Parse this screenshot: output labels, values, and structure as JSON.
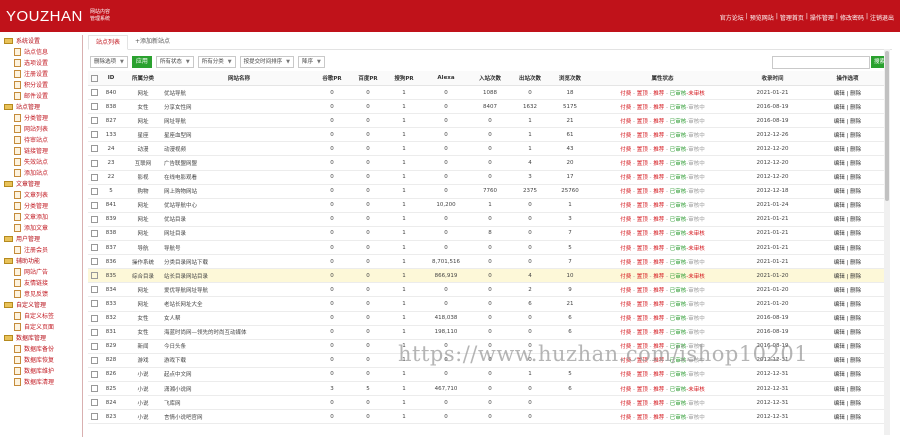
{
  "header": {
    "logo": "YOUZHAN",
    "logo_sub1": "网站内容",
    "logo_sub2": "管理系统",
    "links": [
      "官方论坛",
      "|",
      "预览网站",
      "|",
      "管理首页",
      "|",
      "操作管理",
      "|",
      "修改密码",
      "|",
      "注销退出"
    ]
  },
  "sidebar": {
    "groups": [
      {
        "title": "系统设置",
        "items": [
          "站点信息",
          "选项设置",
          "注册设置",
          "积分设置",
          "邮件设置"
        ]
      },
      {
        "title": "站点管理",
        "items": [
          "分类管理",
          "网站列表",
          "待审站点",
          "链接管理",
          "失效站点",
          "添加站点"
        ]
      },
      {
        "title": "文章管理",
        "items": [
          "文章列表",
          "分类管理",
          "文章添加",
          "添加文章"
        ]
      },
      {
        "title": "用户管理",
        "items": [
          "注册会员"
        ]
      },
      {
        "title": "辅助功能",
        "items": [
          "网站广告",
          "友情链接",
          "意见反馈"
        ]
      },
      {
        "title": "自定义管理",
        "items": [
          "自定义标签",
          "自定义页面"
        ]
      },
      {
        "title": "数据库管理",
        "items": [
          "数据库备份",
          "数据库恢复",
          "数据库维护",
          "数据库清理"
        ]
      }
    ]
  },
  "tabs": [
    "站点列表",
    "+添加新站点"
  ],
  "toolbar": {
    "batch": "删除选项",
    "apply": "应用",
    "status": "所有状态",
    "category": "所有分类",
    "sort_field": "按提交时间排序",
    "order": "降序",
    "search_placeholder": "",
    "search_button": "搜索"
  },
  "table": {
    "headers": [
      "",
      "ID",
      "所属分类",
      "网站名称",
      "谷歌PR",
      "百度PR",
      "搜狗PR",
      "Alexa",
      "入站次数",
      "出站次数",
      "浏览次数",
      "属性状态",
      "收录时间",
      "操作选项"
    ],
    "rows": [
      {
        "id": "840",
        "cat": "网址",
        "name": "优站导航",
        "g": "0",
        "b": "0",
        "s": "1",
        "alexa": "0",
        "in": "1088",
        "out": "0",
        "views": "18",
        "date": "2021-01-21",
        "status": [
          "付费",
          "置顶",
          "推荐",
          "已审核",
          "-未审核"
        ],
        "hl": false
      },
      {
        "id": "838",
        "cat": "女性",
        "name": "分享女性网",
        "g": "0",
        "b": "0",
        "s": "1",
        "alexa": "0",
        "in": "8407",
        "out": "1632",
        "views": "5175",
        "date": "2016-08-19",
        "status": [
          "付费",
          "置顶",
          "推荐",
          "已审核",
          "-审核中"
        ],
        "hl": false
      },
      {
        "id": "827",
        "cat": "网址",
        "name": "网址导航",
        "g": "0",
        "b": "0",
        "s": "1",
        "alexa": "0",
        "in": "0",
        "out": "1",
        "views": "21",
        "date": "2016-08-19",
        "status": [
          "付费",
          "置顶",
          "推荐",
          "已审核",
          "-审核中"
        ],
        "hl": false
      },
      {
        "id": "133",
        "cat": "星座",
        "name": "星座血型网",
        "g": "0",
        "b": "0",
        "s": "1",
        "alexa": "0",
        "in": "0",
        "out": "1",
        "views": "61",
        "date": "2012-12-26",
        "status": [
          "付费",
          "置顶",
          "推荐",
          "已审核",
          "-审核中"
        ],
        "hl": false
      },
      {
        "id": "24",
        "cat": "动漫",
        "name": "动漫视频",
        "g": "0",
        "b": "0",
        "s": "1",
        "alexa": "0",
        "in": "0",
        "out": "1",
        "views": "43",
        "date": "2012-12-20",
        "status": [
          "付费",
          "置顶",
          "推荐",
          "已审核",
          "-审核中"
        ],
        "hl": false
      },
      {
        "id": "23",
        "cat": "互联网",
        "name": "广告联盟网盟",
        "g": "0",
        "b": "0",
        "s": "1",
        "alexa": "0",
        "in": "0",
        "out": "4",
        "views": "20",
        "date": "2012-12-20",
        "status": [
          "付费",
          "置顶",
          "推荐",
          "已审核",
          "-审核中"
        ],
        "hl": false
      },
      {
        "id": "22",
        "cat": "影视",
        "name": "在线电影观看",
        "g": "0",
        "b": "0",
        "s": "1",
        "alexa": "0",
        "in": "0",
        "out": "3",
        "views": "17",
        "date": "2012-12-20",
        "status": [
          "付费",
          "置顶",
          "推荐",
          "已审核",
          "-审核中"
        ],
        "hl": false
      },
      {
        "id": "5",
        "cat": "购物",
        "name": "网上购物网站",
        "g": "0",
        "b": "0",
        "s": "1",
        "alexa": "0",
        "in": "7760",
        "out": "2375",
        "views": "25760",
        "date": "2012-12-18",
        "status": [
          "付费",
          "置顶",
          "推荐",
          "已审核",
          "-审核中"
        ],
        "hl": false
      },
      {
        "id": "841",
        "cat": "网址",
        "name": "优站导航中心",
        "g": "0",
        "b": "0",
        "s": "1",
        "alexa": "10,200",
        "in": "1",
        "out": "0",
        "views": "1",
        "date": "2021-01-24",
        "status": [
          "付费",
          "置顶",
          "推荐",
          "已审核",
          "-审核中"
        ],
        "hl": false
      },
      {
        "id": "839",
        "cat": "网址",
        "name": "优站目录",
        "g": "0",
        "b": "0",
        "s": "1",
        "alexa": "0",
        "in": "0",
        "out": "0",
        "views": "3",
        "date": "2021-01-21",
        "status": [
          "付费",
          "置顶",
          "推荐",
          "已审核",
          "-审核中"
        ],
        "hl": false
      },
      {
        "id": "838",
        "cat": "网址",
        "name": "网址目录",
        "g": "0",
        "b": "0",
        "s": "1",
        "alexa": "0",
        "in": "8",
        "out": "0",
        "views": "7",
        "date": "2021-01-21",
        "status": [
          "付费",
          "置顶",
          "推荐",
          "已审核",
          "-未审核"
        ],
        "hl": false
      },
      {
        "id": "837",
        "cat": "导航",
        "name": "导航号",
        "g": "0",
        "b": "0",
        "s": "1",
        "alexa": "0",
        "in": "0",
        "out": "0",
        "views": "5",
        "date": "2021-01-21",
        "status": [
          "付费",
          "置顶",
          "推荐",
          "已审核",
          "-未审核"
        ],
        "hl": false
      },
      {
        "id": "836",
        "cat": "操作系统",
        "name": "分类目录网站下载",
        "g": "0",
        "b": "0",
        "s": "1",
        "alexa": "8,701,516",
        "in": "0",
        "out": "0",
        "views": "7",
        "date": "2021-01-21",
        "status": [
          "付费",
          "置顶",
          "推荐",
          "已审核",
          "-审核中"
        ],
        "hl": false
      },
      {
        "id": "835",
        "cat": "综合目录",
        "name": "站长目录网站目录",
        "g": "0",
        "b": "0",
        "s": "1",
        "alexa": "866,919",
        "in": "0",
        "out": "4",
        "views": "10",
        "date": "2021-01-20",
        "status": [
          "付费",
          "置顶",
          "推荐",
          "已审核",
          "-未审核"
        ],
        "hl": true
      },
      {
        "id": "834",
        "cat": "网址",
        "name": "爱优导航网址导航",
        "g": "0",
        "b": "0",
        "s": "1",
        "alexa": "0",
        "in": "0",
        "out": "2",
        "views": "9",
        "date": "2021-01-20",
        "status": [
          "付费",
          "置顶",
          "推荐",
          "已审核",
          "-审核中"
        ],
        "hl": false
      },
      {
        "id": "833",
        "cat": "网址",
        "name": "老站长网址大全",
        "g": "0",
        "b": "0",
        "s": "1",
        "alexa": "0",
        "in": "0",
        "out": "6",
        "views": "21",
        "date": "2021-01-20",
        "status": [
          "付费",
          "置顶",
          "推荐",
          "已审核",
          "-审核中"
        ],
        "hl": false
      },
      {
        "id": "832",
        "cat": "女性",
        "name": "女人帮",
        "g": "0",
        "b": "0",
        "s": "1",
        "alexa": "418,038",
        "in": "0",
        "out": "0",
        "views": "6",
        "date": "2016-08-19",
        "status": [
          "付费",
          "置顶",
          "推荐",
          "已审核",
          "-审核中"
        ],
        "hl": false
      },
      {
        "id": "831",
        "cat": "女性",
        "name": "海蓝时尚网—领先的时尚互动媒体",
        "g": "0",
        "b": "0",
        "s": "1",
        "alexa": "198,110",
        "in": "0",
        "out": "0",
        "views": "6",
        "date": "2016-08-19",
        "status": [
          "付费",
          "置顶",
          "推荐",
          "已审核",
          "-审核中"
        ],
        "hl": false
      },
      {
        "id": "829",
        "cat": "新闻",
        "name": "今日头条",
        "g": "0",
        "b": "0",
        "s": "1",
        "alexa": "0",
        "in": "0",
        "out": "0",
        "views": "",
        "date": "2016-08-19",
        "status": [
          "付费",
          "置顶",
          "推荐",
          "已审核",
          "-审核中"
        ],
        "hl": false
      },
      {
        "id": "828",
        "cat": "游戏",
        "name": "游戏下载",
        "g": "0",
        "b": "0",
        "s": "1",
        "alexa": "0",
        "in": "0",
        "out": "0",
        "views": "",
        "date": "2012-12-31",
        "status": [
          "付费",
          "置顶",
          "推荐",
          "已审核",
          "-审核中"
        ],
        "hl": false
      },
      {
        "id": "826",
        "cat": "小说",
        "name": "起点中文网",
        "g": "0",
        "b": "0",
        "s": "1",
        "alexa": "0",
        "in": "0",
        "out": "1",
        "views": "5",
        "date": "2012-12-31",
        "status": [
          "付费",
          "置顶",
          "推荐",
          "已审核",
          "-审核中"
        ],
        "hl": false
      },
      {
        "id": "825",
        "cat": "小说",
        "name": "潇湘小说网",
        "g": "3",
        "b": "5",
        "s": "1",
        "alexa": "467,710",
        "in": "0",
        "out": "0",
        "views": "6",
        "date": "2012-12-31",
        "status": [
          "付费",
          "置顶",
          "推荐",
          "已审核",
          "-未审核"
        ],
        "hl": false
      },
      {
        "id": "824",
        "cat": "小说",
        "name": "飞库网",
        "g": "0",
        "b": "0",
        "s": "1",
        "alexa": "0",
        "in": "0",
        "out": "0",
        "views": "",
        "date": "2012-12-31",
        "status": [
          "付费",
          "置顶",
          "推荐",
          "已审核",
          "-审核中"
        ],
        "hl": false
      },
      {
        "id": "823",
        "cat": "小说",
        "name": "言情小说吧官网",
        "g": "0",
        "b": "0",
        "s": "1",
        "alexa": "0",
        "in": "0",
        "out": "0",
        "views": "",
        "date": "2012-12-31",
        "status": [
          "付费",
          "置顶",
          "推荐",
          "已审核",
          "-审核中"
        ],
        "hl": false
      }
    ],
    "op_edit": "编辑",
    "op_sep": "|",
    "op_delete": "删除"
  },
  "watermark": "https://www.huzhan.com/ishop10201",
  "colors": {
    "brand": "#c0121a",
    "green": "#2aa12f",
    "highlight_row": "#fdf8d8"
  }
}
